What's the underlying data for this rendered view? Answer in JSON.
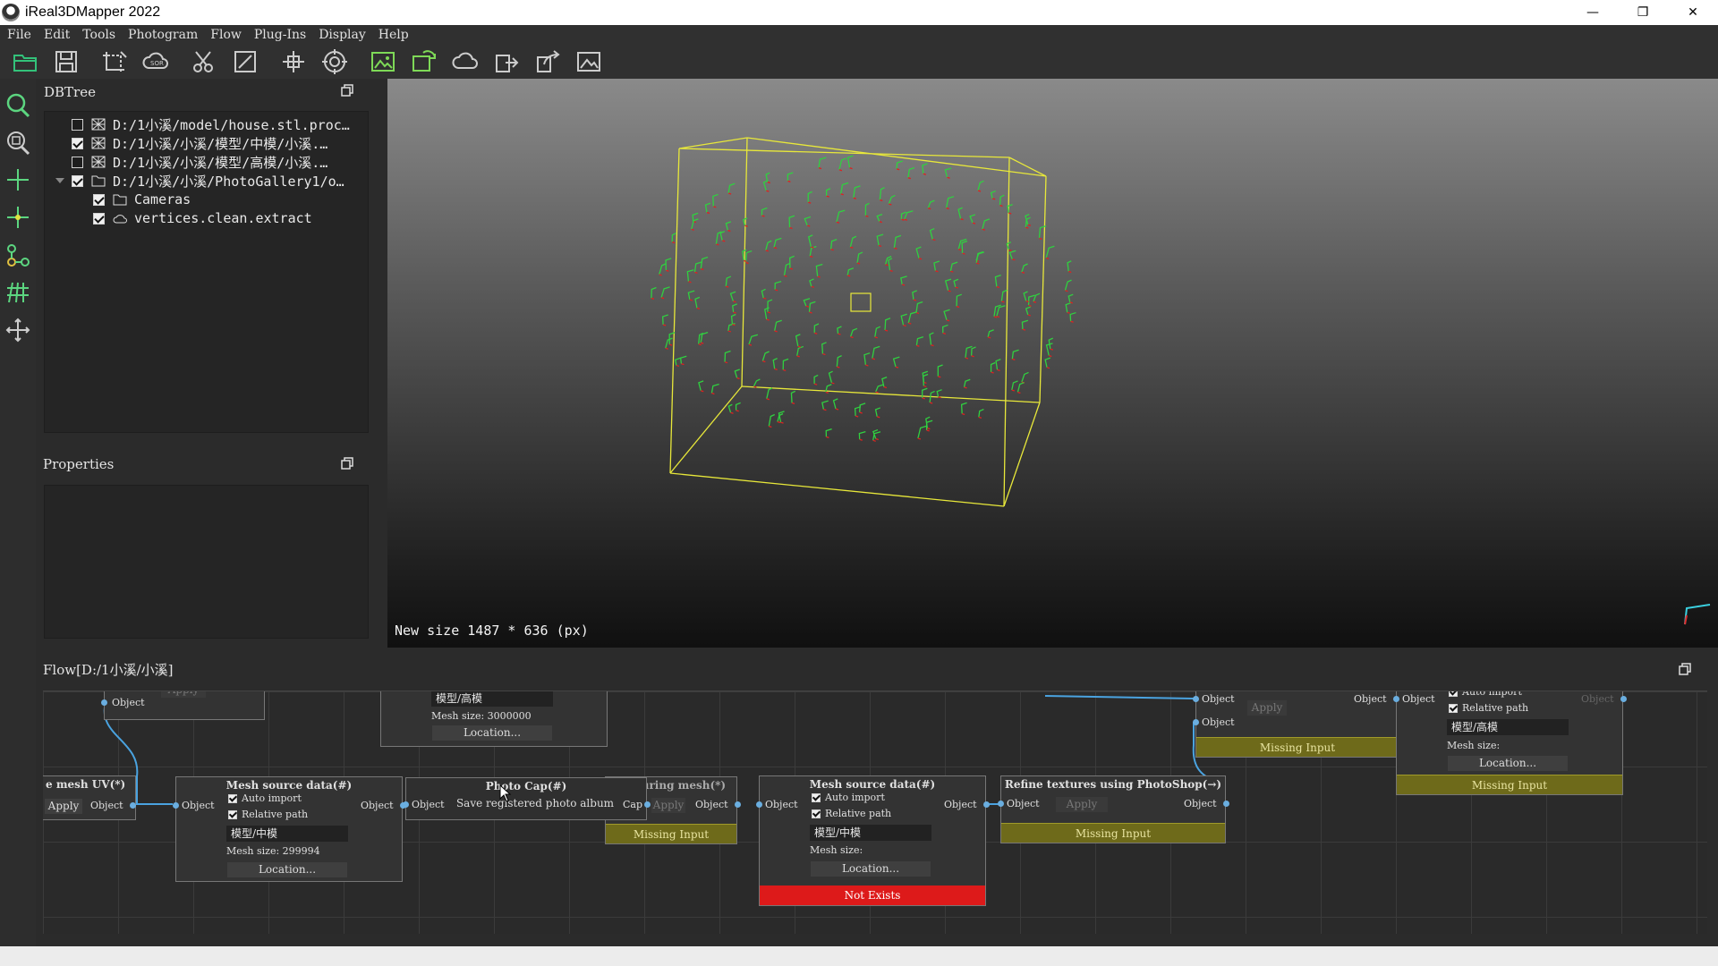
{
  "window": {
    "title": "iReal3DMapper 2022",
    "minimize": "—",
    "restore": "❐",
    "close": "✕"
  },
  "menu": [
    "File",
    "Edit",
    "Tools",
    "Photogram",
    "Flow",
    "Plug-Ins",
    "Display",
    "Help"
  ],
  "toolbar": {
    "icons": [
      "open-folder-icon",
      "save-icon",
      "crop-icon",
      "sor-cloud-icon",
      "scissors-icon",
      "edit-box-icon",
      "transform-icon",
      "target-icon",
      "photo-import-icon",
      "photo-sync-icon",
      "cloud-icon",
      "export-icon",
      "share-icon",
      "image-frame-icon"
    ],
    "sor_label": "SOR"
  },
  "left_tools": [
    "search-icon",
    "zoom-fit-icon",
    "axis-icon",
    "center-point-icon",
    "node-graph-icon",
    "grid-icon",
    "move-icon"
  ],
  "dbtree": {
    "title": "DBTree",
    "items": [
      {
        "label": "D:/1小溪/model/house.stl.proc…",
        "checked": false
      },
      {
        "label": "D:/1小溪/小溪/模型/中模/小溪.…",
        "checked": true
      },
      {
        "label": "D:/1小溪/小溪/模型/高模/小溪.…",
        "checked": false
      },
      {
        "label": "D:/1小溪/小溪/PhotoGallery1/o…",
        "checked": true
      },
      {
        "label": "Cameras",
        "checked": true
      },
      {
        "label": "vertices.clean.extract",
        "checked": true
      }
    ]
  },
  "properties": {
    "title": "Properties"
  },
  "viewport": {
    "status": "New size 1487 * 636 (px)",
    "bbox_color": "#e8e83a",
    "camera_color": "#30d040",
    "axis_color": "#e02020"
  },
  "flow": {
    "title": "Flow[D:/1小溪/小溪]",
    "nodes": {
      "top_left": {
        "port": "Object",
        "apply": "Apply"
      },
      "top_mid": {
        "path": "模型/高模",
        "mesh_size": "Mesh size: 3000000",
        "location": "Location..."
      },
      "mesh_uv": {
        "title": "e mesh UV(*)",
        "apply": "Apply",
        "port": "Object"
      },
      "mesh_src1": {
        "title": "Mesh source data(#)",
        "port_in": "Object",
        "port_out": "Object",
        "auto_import": "Auto import",
        "relative_path": "Relative path",
        "path": "模型/中模",
        "mesh_size": "Mesh size: 299994",
        "location": "Location..."
      },
      "photo_cap": {
        "title": "Photo Cap(#)",
        "port_in": "Object",
        "save": "Save registered photo album",
        "port_out": "Cap"
      },
      "texturing": {
        "title": "Texturing mesh(*)",
        "apply": "Apply",
        "port_out": "Object",
        "status": "Missing Input"
      },
      "mesh_src2": {
        "title": "Mesh source data(#)",
        "port_in": "Object",
        "port_out": "Object",
        "auto_import": "Auto import",
        "relative_path": "Relative path",
        "path": "模型/中模",
        "mesh_size": "Mesh size:",
        "location": "Location...",
        "status": "Not Exists"
      },
      "refine": {
        "title": "Refine textures using PhotoShop(→)",
        "port_in": "Object",
        "apply": "Apply",
        "port_out": "Object",
        "status": "Missing Input"
      },
      "top_right_a": {
        "port_in1": "Object",
        "port_in2": "Object",
        "apply": "Apply",
        "port_out": "Object",
        "status": "Missing Input"
      },
      "top_right_b": {
        "port_in": "Object",
        "auto_import": "Auto import",
        "relative_path": "Relative path",
        "path": "模型/高模",
        "mesh_size": "Mesh size:",
        "location": "Location...",
        "port_out": "Object",
        "status": "Missing Input"
      }
    }
  }
}
